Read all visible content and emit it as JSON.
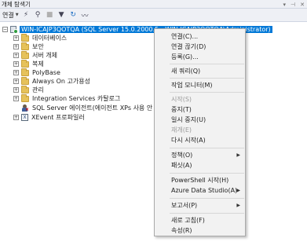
{
  "window": {
    "title": "개체 탐색기",
    "pin_icon": "pin-icon",
    "close_icon": "close-icon"
  },
  "toolbar": {
    "connect_label": "연결",
    "buttons": [
      "connect-icon",
      "disconnect-icon",
      "stop-icon",
      "filter-icon",
      "refresh-icon",
      "activity-monitor-icon"
    ]
  },
  "tree": {
    "server": {
      "label": "WIN-ICAJP3QOTQA (SQL Server 15.0.2000.5 - WIN-ICAJP3QOTQA\\Administrator)"
    },
    "nodes": [
      {
        "label": "데이터베이스"
      },
      {
        "label": "보안"
      },
      {
        "label": "서버 개체"
      },
      {
        "label": "복제"
      },
      {
        "label": "PolyBase"
      },
      {
        "label": "Always On 고가용성"
      },
      {
        "label": "관리"
      },
      {
        "label": "Integration Services 카탈로그"
      }
    ],
    "agent": {
      "label": "SQL Server 에이전트(에이전트 XPs 사용 안 함)"
    },
    "xevent": {
      "label": "XEvent 프로파일러"
    }
  },
  "context_menu": {
    "items": [
      {
        "label": "연결(C)...",
        "disabled": false,
        "submenu": false
      },
      {
        "label": "연결 끊기(D)",
        "disabled": false,
        "submenu": false
      },
      {
        "label": "등록(G)...",
        "disabled": false,
        "submenu": false
      },
      {
        "label": "새 쿼리(Q)",
        "disabled": false,
        "submenu": false
      },
      {
        "label": "작업 모니터(M)",
        "disabled": false,
        "submenu": false
      },
      {
        "label": "시작(S)",
        "disabled": true,
        "submenu": false
      },
      {
        "label": "중지(T)",
        "disabled": false,
        "submenu": false
      },
      {
        "label": "일시 중지(U)",
        "disabled": false,
        "submenu": false
      },
      {
        "label": "재개(E)",
        "disabled": true,
        "submenu": false
      },
      {
        "label": "다시 시작(A)",
        "disabled": false,
        "submenu": false
      },
      {
        "label": "정책(O)",
        "disabled": false,
        "submenu": true
      },
      {
        "label": "패싯(A)",
        "disabled": false,
        "submenu": false
      },
      {
        "label": "PowerShell 시작(H)",
        "disabled": false,
        "submenu": false
      },
      {
        "label": "Azure Data Studio(A)",
        "disabled": false,
        "submenu": true
      },
      {
        "label": "보고서(P)",
        "disabled": false,
        "submenu": true
      },
      {
        "label": "새로 고침(F)",
        "disabled": false,
        "submenu": false
      },
      {
        "label": "속성(R)",
        "disabled": false,
        "submenu": false
      }
    ]
  }
}
